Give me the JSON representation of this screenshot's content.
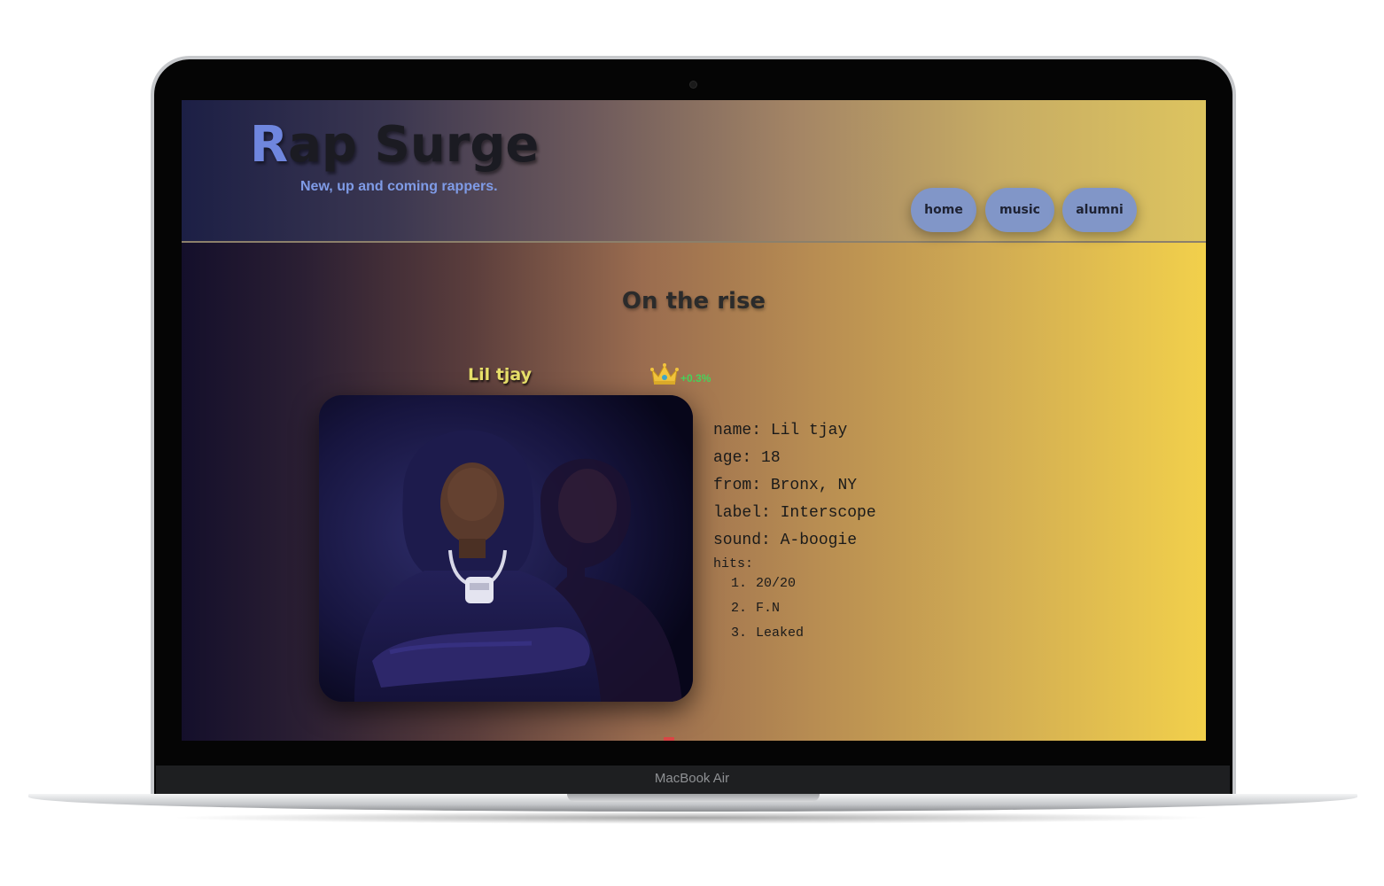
{
  "device": {
    "brand": "MacBook Air"
  },
  "site": {
    "logo_first_letter": "R",
    "logo_rest": "ap Surge",
    "tagline": "New, up and coming rappers."
  },
  "nav": {
    "home": "home",
    "music": "music",
    "alumni": "alumni"
  },
  "section": {
    "title": "On the rise"
  },
  "artist": {
    "name": "Lil tjay",
    "rank_icon": "crown-icon",
    "change": "+0.3%",
    "details": {
      "name_label": "name:",
      "name": "Lil tjay",
      "age_label": "age:",
      "age": "18",
      "from_label": "from:",
      "from": "Bronx, NY",
      "label_label": "label:",
      "label": "Interscope",
      "sound_label": "sound:",
      "sound": "A-boogie",
      "hits_label": "hits:",
      "hits": [
        {
          "num": "1.",
          "title": "20/20"
        },
        {
          "num": "2.",
          "title": "F.N"
        },
        {
          "num": "3.",
          "title": "Leaked"
        }
      ]
    }
  },
  "colors": {
    "accent_blue": "#7f9be6",
    "nav_button": "#8196c8",
    "change_positive": "#46d35a",
    "artist_name": "#e8e06a"
  }
}
